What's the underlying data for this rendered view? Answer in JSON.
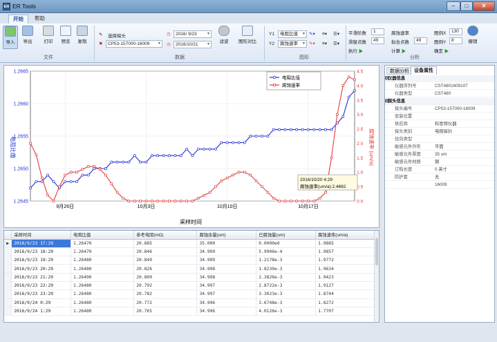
{
  "window": {
    "title": "ER Tools",
    "logo_text": "ER",
    "min": "–",
    "max": "□",
    "close": "✕"
  },
  "menu": {
    "tabs": [
      "开始",
      "帮助"
    ]
  },
  "ribbon": {
    "file": {
      "label": "文件",
      "tools": [
        "导入",
        "导出",
        "打印",
        "预览",
        "复制"
      ]
    },
    "data": {
      "label": "数据",
      "select_probe": "选择探头",
      "probe_value": "CP53-157000-16009",
      "date_from": "2016/ 9/23",
      "date_to": "2016/10/21",
      "filter_label": "滤波",
      "compare_label": "图形对比"
    },
    "graph": {
      "label": "图形",
      "y1_label": "Y1",
      "y1_value": "电阻比值",
      "y2_label": "Y2",
      "y2_value": "腐蚀速率"
    },
    "analysis": {
      "label": "分析",
      "smooth_order_label": "平滑阶数",
      "smooth_order": "1",
      "smooth_points_label": "滑窗点数",
      "smooth_points": "49",
      "execute_label": "执行",
      "rate_label": "腐蚀速率",
      "fit_points_label": "拟合点数",
      "fit_points": "49",
      "calc_label": "计算",
      "legend_x_label": "图例X",
      "legend_x": "130",
      "legend_y_label": "图例Y",
      "legend_y": "8",
      "confirm_label": "确定",
      "undo_label": "撤销"
    }
  },
  "chart_data": {
    "type": "line",
    "xlabel": "采样时间",
    "ylabel_left": "电阻比值",
    "ylabel_right": "腐蚀速率 (um/a)",
    "x_ticks": [
      "9月26日",
      "10月3日",
      "10月10日",
      "10月17日"
    ],
    "y_left_ticks": [
      "1.2665",
      "1.2660",
      "1.2655",
      "1.2650",
      "1.2645"
    ],
    "y_right_ticks": [
      "4.5",
      "4.0",
      "3.5",
      "3.0",
      "2.5",
      "2.0",
      "1.5",
      "1.0",
      "0.5",
      "0.0"
    ],
    "ylim_left": [
      1.2645,
      1.2665
    ],
    "ylim_right": [
      0,
      4.5
    ],
    "xlim_days": [
      0,
      28
    ],
    "grid": true,
    "legend_placement": "top-right",
    "series": [
      {
        "name": "电阻比值",
        "color": "#1f2fd6",
        "axis": "left",
        "x": [
          0,
          0.5,
          1,
          1.5,
          2,
          2.5,
          3,
          3.5,
          4,
          4.5,
          5,
          5.5,
          6,
          6.5,
          7,
          7.5,
          8,
          8.5,
          9,
          9.5,
          10,
          10.5,
          11,
          11.5,
          12,
          12.5,
          13,
          13.5,
          14,
          14.5,
          15,
          15.5,
          16,
          16.5,
          17,
          17.5,
          18,
          18.5,
          19,
          19.5,
          20,
          20.5,
          21,
          21.5,
          22,
          22.5,
          23,
          23.5,
          24,
          24.5,
          25,
          25.5,
          26,
          26.5,
          27,
          27.5,
          28
        ],
        "values": [
          1.2647,
          1.2648,
          1.2648,
          1.2649,
          1.2648,
          1.2647,
          1.2648,
          1.2648,
          1.2648,
          1.2649,
          1.2649,
          1.265,
          1.265,
          1.265,
          1.2651,
          1.2651,
          1.2651,
          1.2651,
          1.2652,
          1.2651,
          1.2651,
          1.2652,
          1.2652,
          1.2652,
          1.2652,
          1.2652,
          1.2652,
          1.2653,
          1.2652,
          1.2653,
          1.2653,
          1.2653,
          1.2653,
          1.2654,
          1.2654,
          1.2654,
          1.2654,
          1.2654,
          1.2655,
          1.2655,
          1.2655,
          1.2655,
          1.2656,
          1.2656,
          1.2656,
          1.2656,
          1.2656,
          1.2656,
          1.2656,
          1.2656,
          1.2656,
          1.2656,
          1.2656,
          1.2657,
          1.2658,
          1.2661,
          1.2662
        ]
      },
      {
        "name": "腐蚀速率",
        "color": "#e23b3b",
        "axis": "right",
        "x": [
          0,
          0.5,
          1,
          1.5,
          2,
          2.5,
          3,
          3.5,
          4,
          4.5,
          5,
          5.5,
          6,
          6.5,
          7,
          7.5,
          8,
          8.5,
          9,
          9.5,
          10,
          10.5,
          11,
          11.5,
          12,
          12.5,
          13,
          13.5,
          14,
          14.5,
          15,
          15.5,
          16,
          16.5,
          17,
          17.5,
          18,
          18.5,
          19,
          19.5,
          20,
          20.5,
          21,
          21.5,
          22,
          22.5,
          23,
          23.5,
          24,
          24.5,
          25,
          25.5,
          26,
          26.5,
          27,
          27.5,
          28
        ],
        "values": [
          2.0,
          1.6,
          0.8,
          0.2,
          0.0,
          0.5,
          0.9,
          1.0,
          1.0,
          1.1,
          1.2,
          1.2,
          1.1,
          0.9,
          0.6,
          0.3,
          0.1,
          0.0,
          0.0,
          0.0,
          0.0,
          0.0,
          0.0,
          0.0,
          0.0,
          0.0,
          0.0,
          0.0,
          0.0,
          0.1,
          0.2,
          0.3,
          0.5,
          0.7,
          0.8,
          0.9,
          1.0,
          1.0,
          0.9,
          0.7,
          0.5,
          0.3,
          0.1,
          0.0,
          0.0,
          0.0,
          0.0,
          0.0,
          0.0,
          0.0,
          0.1,
          0.3,
          1.5,
          3.0,
          4.0,
          4.3,
          4.2
        ]
      }
    ],
    "tooltip": {
      "line1": "2016/10/20 4:29",
      "line2": "腐蚀速率(um/a):2.4662"
    }
  },
  "right_panel": {
    "tabs": [
      "数据分析",
      "设备属性"
    ],
    "rows": [
      {
        "cat": true,
        "k": "仪器信息",
        "v": ""
      },
      {
        "k": "仪器序列号",
        "v": "CST4801609107"
      },
      {
        "k": "仪器类型",
        "v": "CST480"
      },
      {
        "cat": true,
        "k": "探头信息",
        "v": ""
      },
      {
        "k": "探头编号",
        "v": "CP53-157000-16009"
      },
      {
        "k": "安装位置",
        "v": ""
      },
      {
        "k": "供应商",
        "v": "科思特仪器"
      },
      {
        "k": "探头类别",
        "v": "电阻探针"
      },
      {
        "k": "径向类型",
        "v": ""
      },
      {
        "k": "敏感元件外形",
        "v": "平面"
      },
      {
        "k": "敏感元件厚度",
        "v": "35 um"
      },
      {
        "k": "敏感元件材质",
        "v": "钢"
      },
      {
        "k": "订购长度",
        "v": "0 英寸"
      },
      {
        "k": "防护套",
        "v": "无"
      },
      {
        "k": "",
        "v": "16009"
      }
    ]
  },
  "grid": {
    "columns": [
      "采样时间",
      "电阻比值",
      "参考电阻(mΩ)",
      "腐蚀余量(um)",
      "已腐蚀量(um)",
      "腐蚀速率(um/a)"
    ],
    "rows": [
      [
        "2016/9/23 17:29",
        "1.26470",
        "20.885",
        "35.000",
        "0.0000e0",
        "1.9885"
      ],
      [
        "2016/9/23 18:29",
        "1.26470",
        "20.846",
        "34.999",
        "5.9906e-4",
        "1.9857"
      ],
      [
        "2016/9/23 19:29",
        "1.26480",
        "20.849",
        "34.999",
        "1.2178e-3",
        "1.9772"
      ],
      [
        "2016/9/23 20:29",
        "1.26480",
        "20.826",
        "34.998",
        "1.8230e-3",
        "1.9634"
      ],
      [
        "2016/9/23 21:29",
        "1.26490",
        "20.809",
        "34.998",
        "2.3826e-3",
        "1.9423"
      ],
      [
        "2016/9/23 22:29",
        "1.26480",
        "20.792",
        "34.997",
        "2.8722e-3",
        "1.9127"
      ],
      [
        "2016/9/23 23:29",
        "1.26480",
        "20.782",
        "34.997",
        "3.3023e-3",
        "1.8744"
      ],
      [
        "2016/9/24 0:29",
        "1.26480",
        "20.772",
        "34.996",
        "3.6748e-3",
        "1.8272"
      ],
      [
        "2016/9/24 1:29",
        "1.26480",
        "20.765",
        "34.996",
        "4.0126e-3",
        "1.7707"
      ]
    ],
    "selected_marker": "▶"
  },
  "colors": {
    "accent": "#3b78d8",
    "series1": "#1f2fd6",
    "series2": "#e23b3b"
  }
}
